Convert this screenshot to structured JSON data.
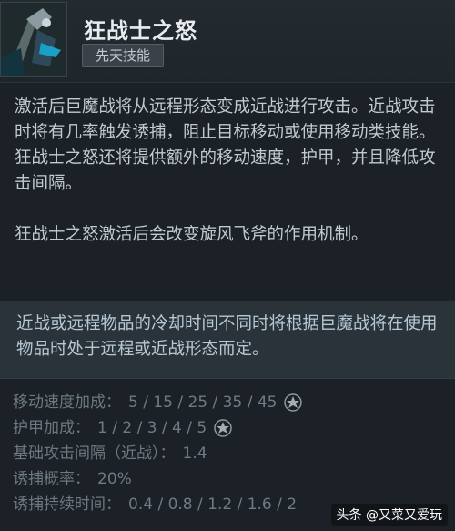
{
  "ability": {
    "title": "狂战士之怒",
    "badge": "先天技能",
    "icon": "berserkers-rage-portrait"
  },
  "description": {
    "paragraph1": "激活后巨魔战将从远程形态变成近战进行攻击。近战攻击时将有几率触发诱捕，阻止目标移动或使用移动类技能。狂战士之怒还将提供额外的移动速度，护甲，并且降低攻击间隔。",
    "paragraph2": "狂战士之怒激活后会改变旋风飞斧的作用机制。"
  },
  "note": {
    "text": "近战或远程物品的冷却时间不同时将根据巨魔战将在使用物品时处于远程或近战形态而定。"
  },
  "stats": [
    {
      "label": "移动速度加成：",
      "value": "5 / 15 / 25 / 35 / 45",
      "aghs": true
    },
    {
      "label": "护甲加成：",
      "value": "1 / 2 / 3 / 4 / 5",
      "aghs": true
    },
    {
      "label": "基础攻击间隔（近战）：",
      "value": "1.4",
      "aghs": false
    },
    {
      "label": "诱捕概率：",
      "value": "20%",
      "aghs": false
    },
    {
      "label": "诱捕持续时间：",
      "value": "0.4 / 0.8 / 1.2 / 1.6 / 2",
      "aghs": false
    }
  ],
  "watermark": "头条 @又菜又爱玩",
  "colors": {
    "background": "#1b2126",
    "note_background": "#2a333a",
    "stat_text": "#6d7880",
    "title": "#e8ecef"
  }
}
